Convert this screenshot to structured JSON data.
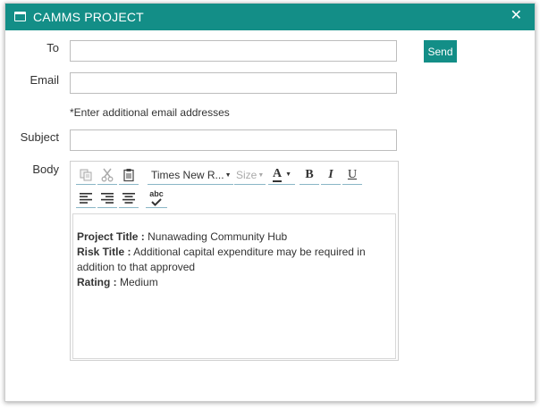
{
  "window": {
    "title": "CAMMS PROJECT",
    "close_glyph": "✕"
  },
  "form": {
    "to_label": "To",
    "to_value": "",
    "email_label": "Email",
    "email_value": "",
    "email_note": "*Enter additional email addresses",
    "subject_label": "Subject",
    "subject_value": "",
    "body_label": "Body",
    "send_label": "Send"
  },
  "toolbar": {
    "font_name": "Times New R...",
    "font_size_placeholder": "Size",
    "font_color_glyph": "A",
    "bold_glyph": "B",
    "italic_glyph": "I",
    "underline_glyph": "U",
    "spellcheck_glyph": "abc",
    "icons": [
      "copy-icon",
      "cut-icon",
      "paste-icon",
      "font-color-icon",
      "bold-icon",
      "italic-icon",
      "underline-icon",
      "align-left-icon",
      "align-right-icon",
      "align-center-icon",
      "spellcheck-icon"
    ]
  },
  "body_content": {
    "project_title_label": "Project Title :",
    "project_title_value": "Nunawading Community Hub",
    "risk_title_label": "Risk Title :",
    "risk_title_value": "Additional capital expenditure may be required in addition to that approved",
    "rating_label": "Rating :",
    "rating_value": "Medium"
  },
  "colors": {
    "brand": "#138e87",
    "toolbar_underline": "#8ab6c6"
  }
}
